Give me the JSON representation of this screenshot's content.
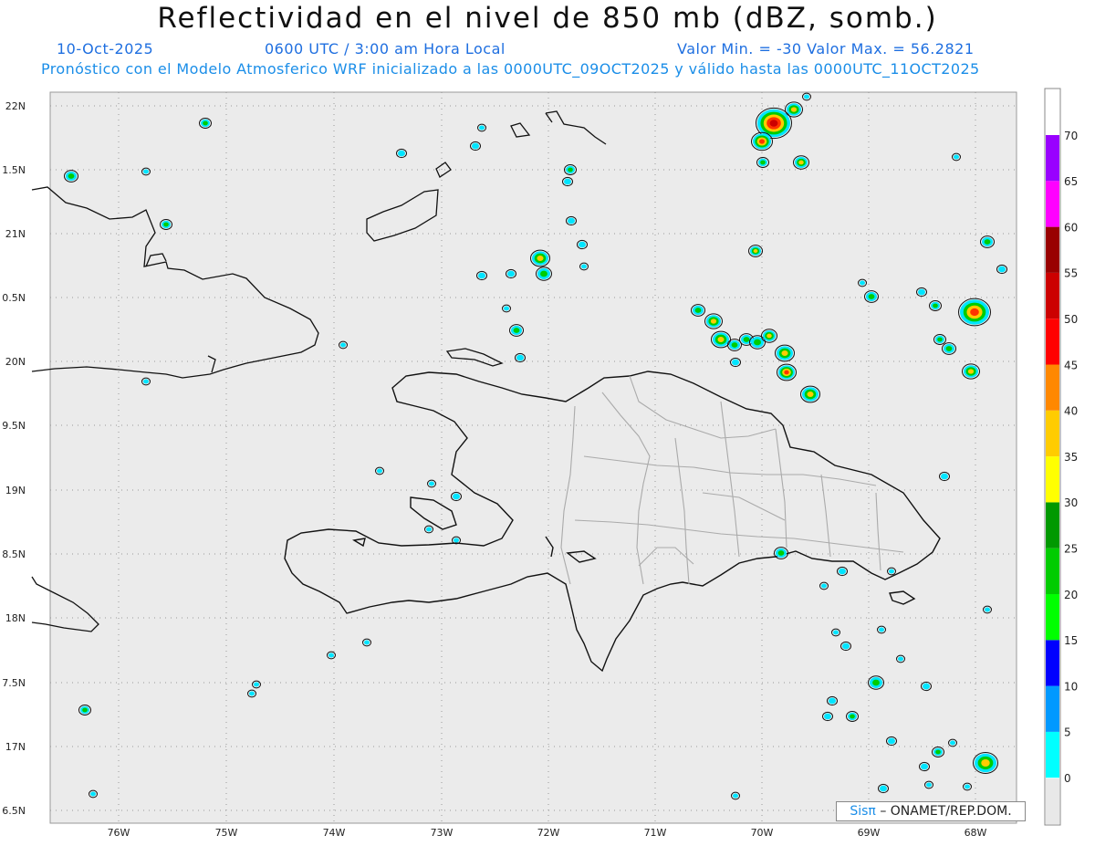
{
  "header": {
    "title": "Reflectividad en el nivel de 850 mb (dBZ, somb.)",
    "date": "10-Oct-2025",
    "time": "0600 UTC / 3:00 am Hora Local",
    "range": "Valor Min. = -30  Valor Max. = 56.2821",
    "description": "Pronóstico con el Modelo Atmosferico WRF inicializado a las 0000UTC_09OCT2025 y válido hasta las  0000UTC_11OCT2025"
  },
  "map": {
    "lon_ticks": [
      "76W",
      "75W",
      "74W",
      "73W",
      "72W",
      "71W",
      "70W",
      "69W",
      "68W"
    ],
    "lat_ticks": [
      "22N",
      "1.5N",
      "21N",
      "0.5N",
      "20N",
      "9.5N",
      "19N",
      "8.5N",
      "18N",
      "7.5N",
      "17N",
      "6.5N"
    ]
  },
  "colorbar": {
    "ticks": [
      "0",
      "5",
      "10",
      "15",
      "20",
      "25",
      "30",
      "35",
      "40",
      "45",
      "50",
      "55",
      "60",
      "65",
      "70"
    ],
    "colors": [
      "#00ffff",
      "#0099ff",
      "#0000ff",
      "#00ff00",
      "#00cc00",
      "#009900",
      "#ffff00",
      "#ffcc00",
      "#ff8800",
      "#ff0000",
      "#cc0000",
      "#990000",
      "#ff00ff",
      "#9900ff",
      "#ffffff"
    ]
  },
  "credit": {
    "brand": "Sisπ",
    "org": "– ONAMET/REP.DOM."
  }
}
